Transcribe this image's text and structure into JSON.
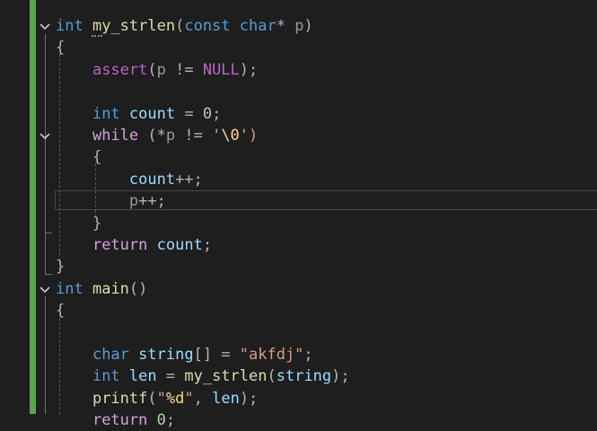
{
  "editor": {
    "language": "C",
    "code": [
      {
        "tokens": [
          {
            "t": "int",
            "c": "kw"
          },
          {
            "t": " ",
            "c": ""
          },
          {
            "t": "my_strlen",
            "c": "fn"
          },
          {
            "t": "(",
            "c": "punc"
          },
          {
            "t": "const",
            "c": "kw"
          },
          {
            "t": " ",
            "c": ""
          },
          {
            "t": "char",
            "c": "kw"
          },
          {
            "t": "* ",
            "c": "punc"
          },
          {
            "t": "p",
            "c": "param"
          },
          {
            "t": ")",
            "c": "punc"
          }
        ]
      },
      {
        "tokens": [
          {
            "t": "{",
            "c": "punc"
          }
        ]
      },
      {
        "tokens": [
          {
            "t": "    ",
            "c": ""
          },
          {
            "t": "assert",
            "c": "macro"
          },
          {
            "t": "(",
            "c": "punc"
          },
          {
            "t": "p",
            "c": "param"
          },
          {
            "t": " != ",
            "c": "punc"
          },
          {
            "t": "NULL",
            "c": "macro"
          },
          {
            "t": ");",
            "c": "punc"
          }
        ]
      },
      {
        "tokens": []
      },
      {
        "tokens": [
          {
            "t": "    ",
            "c": ""
          },
          {
            "t": "int",
            "c": "kw"
          },
          {
            "t": " ",
            "c": ""
          },
          {
            "t": "count",
            "c": "var"
          },
          {
            "t": " = ",
            "c": "punc"
          },
          {
            "t": "0",
            "c": "num"
          },
          {
            "t": ";",
            "c": "punc"
          }
        ]
      },
      {
        "tokens": [
          {
            "t": "    ",
            "c": ""
          },
          {
            "t": "while",
            "c": "flow"
          },
          {
            "t": " (*",
            "c": "punc"
          },
          {
            "t": "p",
            "c": "param"
          },
          {
            "t": " != ",
            "c": "punc"
          },
          {
            "t": "'",
            "c": "str"
          },
          {
            "t": "\\0",
            "c": "esc"
          },
          {
            "t": "')",
            "c": "str"
          }
        ]
      },
      {
        "tokens": [
          {
            "t": "    ",
            "c": ""
          },
          {
            "t": "{",
            "c": "punc"
          }
        ]
      },
      {
        "tokens": [
          {
            "t": "        ",
            "c": ""
          },
          {
            "t": "count",
            "c": "var"
          },
          {
            "t": "++;",
            "c": "punc"
          }
        ]
      },
      {
        "tokens": [
          {
            "t": "        ",
            "c": ""
          },
          {
            "t": "p",
            "c": "param"
          },
          {
            "t": "++;",
            "c": "punc"
          }
        ]
      },
      {
        "tokens": [
          {
            "t": "    ",
            "c": ""
          },
          {
            "t": "}",
            "c": "punc"
          }
        ]
      },
      {
        "tokens": [
          {
            "t": "    ",
            "c": ""
          },
          {
            "t": "return",
            "c": "flow"
          },
          {
            "t": " ",
            "c": ""
          },
          {
            "t": "count",
            "c": "var"
          },
          {
            "t": ";",
            "c": "punc"
          }
        ]
      },
      {
        "tokens": [
          {
            "t": "}",
            "c": "punc"
          }
        ]
      },
      {
        "tokens": [
          {
            "t": "int",
            "c": "kw"
          },
          {
            "t": " ",
            "c": ""
          },
          {
            "t": "main",
            "c": "fn"
          },
          {
            "t": "()",
            "c": "punc"
          }
        ]
      },
      {
        "tokens": [
          {
            "t": "{",
            "c": "punc"
          }
        ]
      },
      {
        "tokens": []
      },
      {
        "tokens": [
          {
            "t": "    ",
            "c": ""
          },
          {
            "t": "char",
            "c": "kw"
          },
          {
            "t": " ",
            "c": ""
          },
          {
            "t": "string",
            "c": "var"
          },
          {
            "t": "[] = ",
            "c": "punc"
          },
          {
            "t": "\"akfdj\"",
            "c": "str"
          },
          {
            "t": ";",
            "c": "punc"
          }
        ]
      },
      {
        "tokens": [
          {
            "t": "    ",
            "c": ""
          },
          {
            "t": "int",
            "c": "kw"
          },
          {
            "t": " ",
            "c": ""
          },
          {
            "t": "len",
            "c": "var"
          },
          {
            "t": " = ",
            "c": "punc"
          },
          {
            "t": "my_strlen",
            "c": "fn"
          },
          {
            "t": "(",
            "c": "punc"
          },
          {
            "t": "string",
            "c": "var"
          },
          {
            "t": ");",
            "c": "punc"
          }
        ]
      },
      {
        "tokens": [
          {
            "t": "    ",
            "c": ""
          },
          {
            "t": "printf",
            "c": "fn"
          },
          {
            "t": "(",
            "c": "punc"
          },
          {
            "t": "\"",
            "c": "str"
          },
          {
            "t": "%d",
            "c": "esc"
          },
          {
            "t": "\"",
            "c": "str"
          },
          {
            "t": ", ",
            "c": "punc"
          },
          {
            "t": "len",
            "c": "var"
          },
          {
            "t": ");",
            "c": "punc"
          }
        ]
      },
      {
        "tokens": [
          {
            "t": "    ",
            "c": ""
          },
          {
            "t": "return",
            "c": "flow"
          },
          {
            "t": " ",
            "c": ""
          },
          {
            "t": "0",
            "c": "num"
          },
          {
            "t": ";",
            "c": "punc"
          }
        ]
      }
    ],
    "folds": [
      0,
      5,
      12
    ],
    "current_line": 8
  }
}
